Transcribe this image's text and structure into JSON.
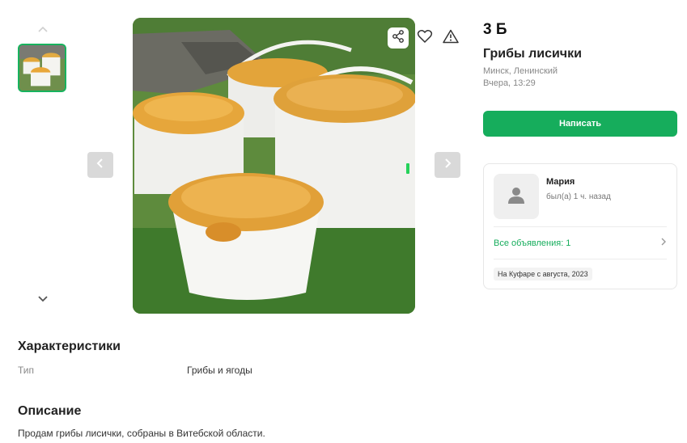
{
  "listing": {
    "price": "3 Б",
    "title": "Грибы лисички",
    "location": "Минск, Ленинский",
    "posted": "Вчера, 13:29",
    "write_button": "Написать"
  },
  "gallery": {
    "actions": [
      "share-icon",
      "heart-icon",
      "alert-icon"
    ],
    "nav": [
      "chevron-left-icon",
      "chevron-right-icon"
    ],
    "thumb_nav": [
      "chevron-up-icon",
      "chevron-down-icon"
    ]
  },
  "seller": {
    "name": "Мария",
    "status": "был(а) 1 ч. назад",
    "all_ads": "Все объявления: 1",
    "since": "На Куфаре с августа, 2023"
  },
  "characteristics": {
    "heading": "Характеристики",
    "rows": [
      {
        "key": "Тип",
        "value": "Грибы и ягоды"
      }
    ]
  },
  "description": {
    "heading": "Описание",
    "text": "Продам грибы лисички, собраны в Витебской области."
  },
  "colors": {
    "accent": "#16ad5c",
    "indicator": "#25d25a"
  }
}
